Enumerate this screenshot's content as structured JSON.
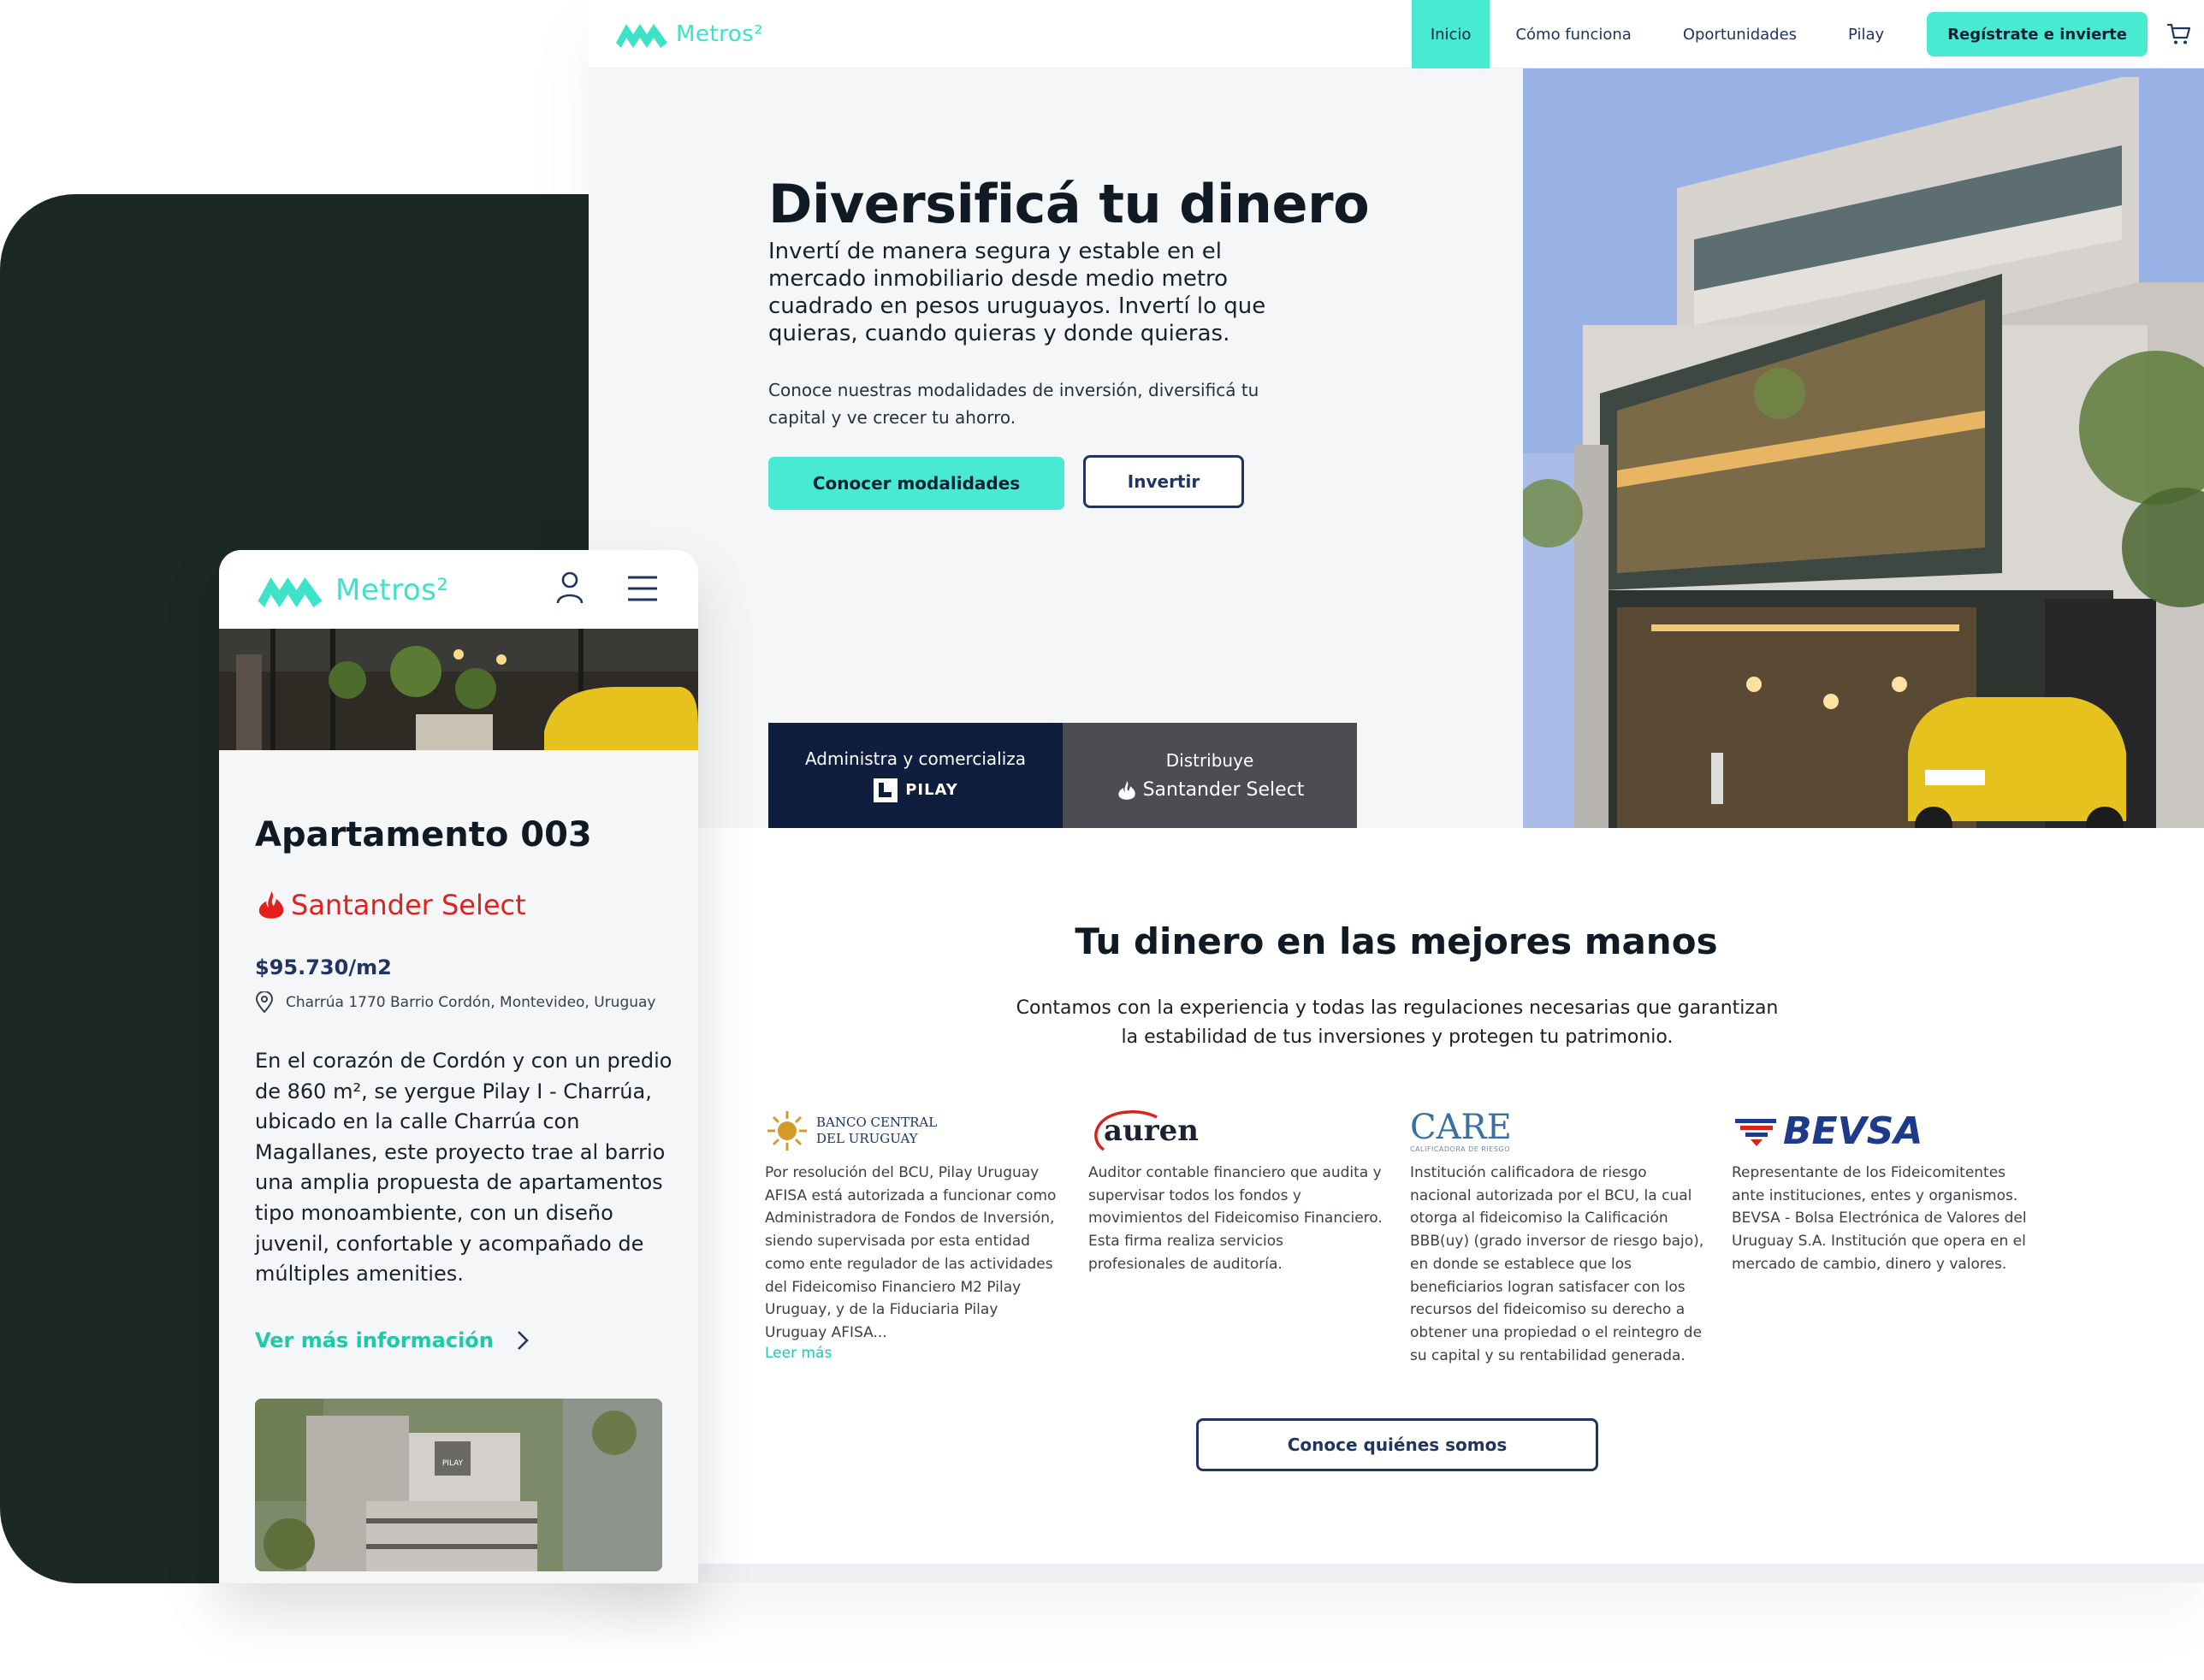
{
  "colors": {
    "accent": "#48ead2",
    "navy": "#1f3560",
    "dark_bg": "#1b2825",
    "brand_red": "#e5201c"
  },
  "desktop": {
    "logo": {
      "text": "Metros²"
    },
    "nav": {
      "items": [
        "Inicio",
        "Cómo funciona",
        "Oportunidades",
        "Pilay"
      ],
      "active": "Inicio",
      "cta": "Regístrate e invierte",
      "cart_icon": "cart-icon"
    },
    "hero": {
      "title": "Diversificá tu dinero",
      "lead": "Invertí de manera segura y estable en el mercado inmobiliario desde medio metro cuadrado en pesos uruguayos. Invertí lo que quieras, cuando quieras y donde quieras.",
      "body": "Conoce nuestras modalidades de inversión, diversificá tu capital y ve crecer tu ahorro.",
      "primary_button": "Conocer modalidades",
      "secondary_button": "Invertir",
      "badge_admin": {
        "caption": "Administra y comercializa",
        "brand": "PILAY"
      },
      "badge_dist": {
        "caption": "Distribuye",
        "brand": "Santander Select"
      }
    },
    "trust": {
      "title": "Tu dinero en las mejores manos",
      "lead": "Contamos con la experiencia y todas las regulaciones necesarias que garantizan la estabilidad de tus inversiones y protegen tu patrimonio.",
      "columns": [
        {
          "logo_line1": "BANCO CENTRAL",
          "logo_line2": "DEL URUGUAY",
          "text": "Por resolución del BCU, Pilay Uruguay AFISA está autorizada a funcionar como Administradora de Fondos de Inversión, siendo supervisada por esta entidad como ente regulador de las actividades del Fideicomiso Financiero M2 Pilay Uruguay, y de la Fiduciaria Pilay Uruguay AFISA...",
          "more": "Leer más"
        },
        {
          "logo": "auren",
          "text": "Auditor contable financiero que audita y supervisar todos los fondos y movimientos del Fideicomiso Financiero. Esta firma realiza servicios profesionales de auditoría."
        },
        {
          "logo": "CARE",
          "logo_sub": "CALIFICADORA DE RIESGO",
          "text": "Institución calificadora de riesgo nacional autorizada por el BCU, la cual otorga al fideicomiso la Calificación BBB(uy) (grado inversor de riesgo bajo), en donde se establece que los beneficiarios logran satisfacer con los recursos del fideicomiso su derecho a obtener una propiedad o el reintegro de su capital y su rentabilidad generada."
        },
        {
          "logo": "BEVSA",
          "text": "Representante de los Fideicomitentes ante instituciones, entes y organismos. BEVSA - Bolsa Electrónica de Valores del Uruguay S.A. Institución que opera en el mercado de cambio, dinero y valores."
        }
      ],
      "about_button": "Conoce quiénes somos"
    }
  },
  "mobile": {
    "logo": {
      "text": "Metros²"
    },
    "title": "Apartamento 003",
    "brand": "Santander Select",
    "price": "$95.730/m2",
    "address": "Charrúa 1770 Barrio Cordón, Montevideo, Uruguay",
    "description": "En el corazón de Cordón y con un predio de 860 m², se yergue Pilay I - Charrúa, ubicado en la calle Charrúa con Magallanes, este proyecto trae al barrio una amplia propuesta de apartamentos tipo monoambiente, con un diseño juvenil, confortable y acompañado de múltiples amenities.",
    "more": "Ver más información",
    "building_sign": "PILAY"
  }
}
